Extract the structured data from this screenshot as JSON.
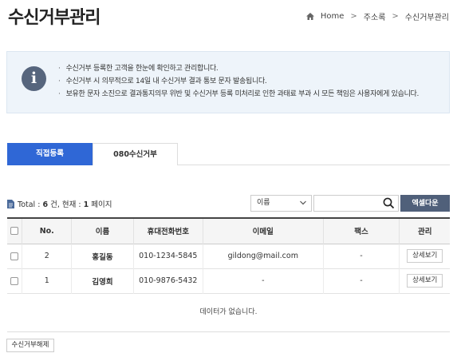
{
  "page": {
    "title": "수신거부관리"
  },
  "breadcrumb": {
    "home": "Home",
    "item1": "주소록",
    "item2": "수신거부관리",
    "sep": ">"
  },
  "info": {
    "icon_glyph": "i",
    "lines": [
      "수신거부 등록한 고객을 한눈에 확인하고 관리합니다.",
      "수신거부 시 의무적으로 14일 내 수신거부 결과 통보 문자 발송됩니다.",
      "보유한 문자 소진으로 결과통지의무 위반 및 수신거부 등록 미처리로 인한 과태료 부과 시 모든 책임은 사용자에게 있습니다."
    ]
  },
  "tabs": {
    "direct": "직접등록",
    "reject080": "080수신거부"
  },
  "summary": {
    "total_label": "Total : ",
    "total_count": "6",
    "unit1": " 건, 현재 : ",
    "current_page": "1",
    "unit2": " 페이지"
  },
  "search": {
    "select_value": "이름",
    "query": ""
  },
  "buttons": {
    "excel": "엑셀다운",
    "detail": "상세보기",
    "release": "수신거부해제"
  },
  "table": {
    "headers": {
      "no": "No.",
      "name": "이름",
      "phone": "휴대전화번호",
      "email": "이메일",
      "fax": "팩스",
      "manage": "관리"
    },
    "rows": [
      {
        "no": "2",
        "name": "홍길동",
        "phone": "010-1234-5845",
        "email": "gildong@mail.com",
        "fax": "-"
      },
      {
        "no": "1",
        "name": "김영희",
        "phone": "010-9876-5432",
        "email": "-",
        "fax": "-"
      }
    ]
  },
  "empty_message": "데이터가 없습니다.",
  "colors": {
    "accent": "#2f67d6",
    "dark_button": "#50607a",
    "info_bg": "#eef4fa"
  }
}
